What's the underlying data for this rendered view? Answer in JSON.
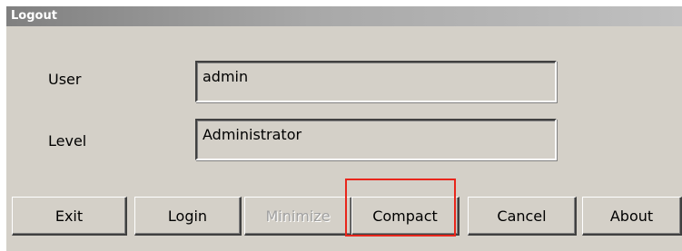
{
  "window": {
    "title": "Logout"
  },
  "form": {
    "user_label": "User",
    "user_value": "admin",
    "level_label": "Level",
    "level_value": "Administrator"
  },
  "buttons": {
    "exit": "Exit",
    "login": "Login",
    "minimize": "Minimize",
    "compact": "Compact",
    "cancel": "Cancel",
    "about": "About"
  },
  "annotation": {
    "highlight_target": "compact-button",
    "highlight_color": "#e8261c"
  }
}
